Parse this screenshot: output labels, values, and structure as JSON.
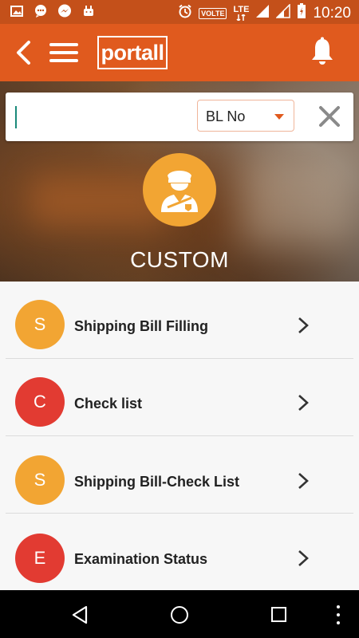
{
  "status_bar": {
    "icons_left": [
      "image-icon",
      "chat-icon",
      "messenger-icon",
      "android-icon"
    ],
    "volte": "VOLTE",
    "network": "LTE",
    "time": "10:20"
  },
  "app_bar": {
    "logo_text": "portall",
    "icons": [
      "back-arrow-icon",
      "hamburger-menu-icon",
      "bell-icon"
    ]
  },
  "search": {
    "value": "",
    "placeholder": "",
    "filter_selected": "BL No",
    "clear_icon": "close-icon"
  },
  "hero": {
    "title": "CUSTOM",
    "icon": "customs-officer-icon"
  },
  "list": [
    {
      "initial": "S",
      "label": "Shipping Bill Filling",
      "color": "#f2a533"
    },
    {
      "initial": "C",
      "label": "Check list",
      "color": "#e23b32"
    },
    {
      "initial": "S",
      "label": "Shipping Bill-Check List",
      "color": "#f2a533"
    },
    {
      "initial": "E",
      "label": "Examination Status",
      "color": "#e23b32"
    }
  ],
  "colors": {
    "app_bar": "#e05a1e",
    "status_bar": "#c4501a",
    "accent_orange": "#f2a533",
    "accent_red": "#e23b32"
  }
}
